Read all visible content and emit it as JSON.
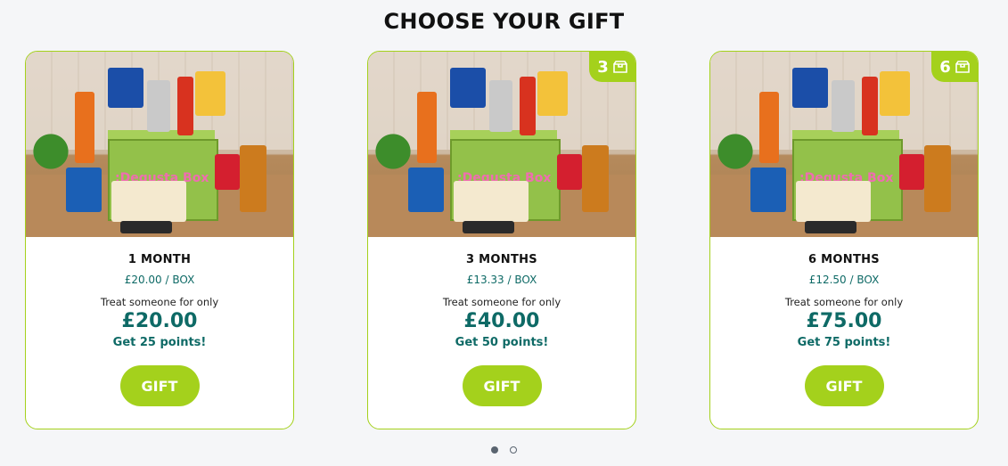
{
  "heading": "CHOOSE YOUR GIFT",
  "cards": [
    {
      "duration": "1 MONTH",
      "per_box": "£20.00 / BOX",
      "treat": "Treat someone for only",
      "price": "£20.00",
      "points": "Get 25 points!",
      "button": "GIFT",
      "badge": ""
    },
    {
      "duration": "3 MONTHS",
      "per_box": "£13.33 / BOX",
      "treat": "Treat someone for only",
      "price": "£40.00",
      "points": "Get 50 points!",
      "button": "GIFT",
      "badge": "3"
    },
    {
      "duration": "6 MONTHS",
      "per_box": "£12.50 / BOX",
      "treat": "Treat someone for only",
      "price": "£75.00",
      "points": "Get 75 points!",
      "button": "GIFT",
      "badge": "6"
    }
  ],
  "photo": {
    "box_label": ":Degusta Box"
  },
  "carousel": {
    "pages": 2,
    "active": 1
  },
  "colors": {
    "accent": "#a4d11c",
    "price": "#0e6a66",
    "border": "#a4d11c"
  }
}
